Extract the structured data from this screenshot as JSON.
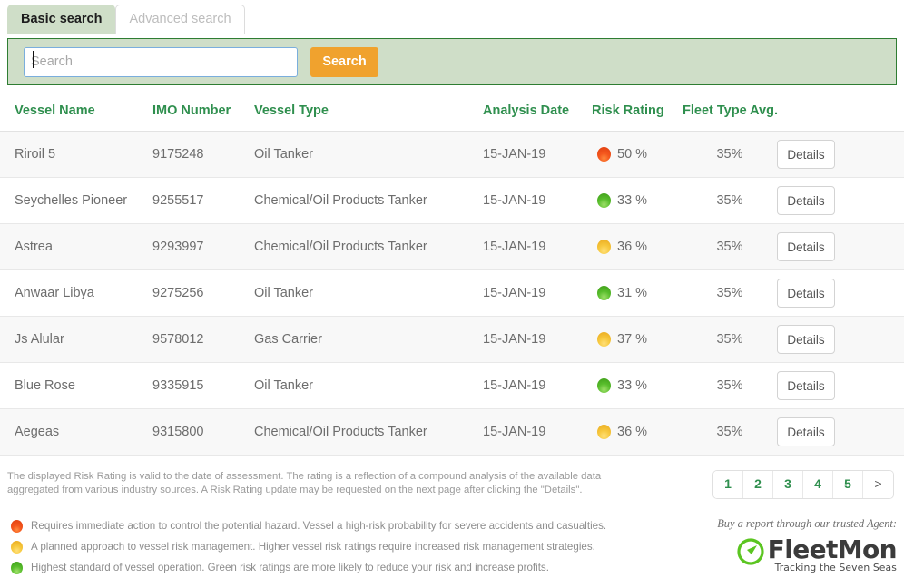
{
  "tabs": [
    {
      "label": "Basic search",
      "active": true
    },
    {
      "label": "Advanced search",
      "active": false
    }
  ],
  "search": {
    "placeholder": "Search",
    "value": "",
    "button_label": "Search"
  },
  "table": {
    "columns": [
      "Vessel Name",
      "IMO Number",
      "Vessel Type",
      "Analysis Date",
      "Risk Rating",
      "Fleet Type Avg.",
      ""
    ],
    "rows": [
      {
        "vessel_name": "Riroil 5",
        "imo_number": "9175248",
        "vessel_type": "Oil Tanker",
        "analysis_date": "15-JAN-19",
        "risk_value": "50 %",
        "risk_color": "red",
        "fleet_type_avg": "35%",
        "action_label": "Details"
      },
      {
        "vessel_name": "Seychelles Pioneer",
        "imo_number": "9255517",
        "vessel_type": "Chemical/Oil Products Tanker",
        "analysis_date": "15-JAN-19",
        "risk_value": "33 %",
        "risk_color": "green",
        "fleet_type_avg": "35%",
        "action_label": "Details"
      },
      {
        "vessel_name": "Astrea",
        "imo_number": "9293997",
        "vessel_type": "Chemical/Oil Products Tanker",
        "analysis_date": "15-JAN-19",
        "risk_value": "36 %",
        "risk_color": "yellow",
        "fleet_type_avg": "35%",
        "action_label": "Details"
      },
      {
        "vessel_name": "Anwaar Libya",
        "imo_number": "9275256",
        "vessel_type": "Oil Tanker",
        "analysis_date": "15-JAN-19",
        "risk_value": "31 %",
        "risk_color": "green",
        "fleet_type_avg": "35%",
        "action_label": "Details"
      },
      {
        "vessel_name": "Js Alular",
        "imo_number": "9578012",
        "vessel_type": "Gas Carrier",
        "analysis_date": "15-JAN-19",
        "risk_value": "37 %",
        "risk_color": "yellow",
        "fleet_type_avg": "35%",
        "action_label": "Details"
      },
      {
        "vessel_name": "Blue Rose",
        "imo_number": "9335915",
        "vessel_type": "Oil Tanker",
        "analysis_date": "15-JAN-19",
        "risk_value": "33 %",
        "risk_color": "green",
        "fleet_type_avg": "35%",
        "action_label": "Details"
      },
      {
        "vessel_name": "Aegeas",
        "imo_number": "9315800",
        "vessel_type": "Chemical/Oil Products Tanker",
        "analysis_date": "15-JAN-19",
        "risk_value": "36 %",
        "risk_color": "yellow",
        "fleet_type_avg": "35%",
        "action_label": "Details"
      }
    ]
  },
  "disclaimer": "The displayed Risk Rating is valid to the date of assessment. The rating is a reflection of a compound analysis of the available data aggregated from various industry sources. A Risk Rating update may be requested on the next page after clicking the \"Details\".",
  "pagination": {
    "pages": [
      "1",
      "2",
      "3",
      "4",
      "5"
    ],
    "next_label": ">",
    "current": "1"
  },
  "legend": [
    {
      "color": "red",
      "text": "Requires immediate action to control the potential hazard. Vessel a high-risk probability for severe accidents and casualties."
    },
    {
      "color": "yellow",
      "text": "A planned approach to vessel risk management. Higher vessel risk ratings require increased risk management strategies."
    },
    {
      "color": "green",
      "text": "Highest standard of vessel operation. Green risk ratings are more likely to reduce your risk and increase profits."
    }
  ],
  "agent": {
    "note": "Buy a report through our trusted Agent:",
    "logo_word": "FleetMon",
    "logo_tagline": "Tracking the Seven Seas",
    "logo_color": "#5bc521"
  },
  "colors": {
    "brand_green": "#2f8f4e",
    "panel_green": "#cfdec8",
    "panel_border": "#2e7d32",
    "search_orange": "#f0a22e",
    "risk_red": "#e8491c",
    "risk_yellow": "#f0c23a",
    "risk_green": "#4eb324"
  }
}
